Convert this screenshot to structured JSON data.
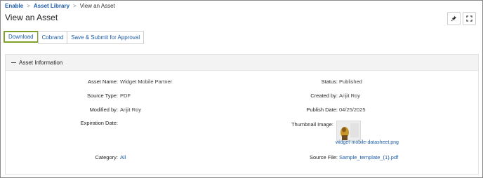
{
  "breadcrumb": {
    "items": [
      "Enable",
      "Asset Library"
    ],
    "current": "View an Asset"
  },
  "page_title": "View an Asset",
  "header_icons": [
    "pin-icon",
    "expand-icon"
  ],
  "toolbar": {
    "download": "Download",
    "cobrand": "Cobrand",
    "save_submit": "Save & Submit for Approval"
  },
  "panel": {
    "title": "Asset Information"
  },
  "fields": {
    "asset_name_label": "Asset Name:",
    "asset_name": "Widget Mobile Partner",
    "source_type_label": "Source Type:",
    "source_type": "PDF",
    "modified_by_label": "Modified by:",
    "modified_by": "Arijit Roy",
    "expiration_date_label": "Expiration Date:",
    "category_label": "Category:",
    "category": "All",
    "status_label": "Status:",
    "status": "Published",
    "created_by_label": "Created by:",
    "created_by": "Arijit Roy",
    "publish_date_label": "Publish Date:",
    "publish_date": "04/25/2025",
    "thumbnail_label": "Thumbnail Image:",
    "thumbnail_file": "widget-mobile-datasheet.png",
    "source_file_label": "Source File:",
    "source_file": "Sample_template_(1).pdf"
  },
  "colors": {
    "link": "#1a5aa8",
    "selected_border": "#7fa02a",
    "panel_header": "#f3f3f3"
  }
}
